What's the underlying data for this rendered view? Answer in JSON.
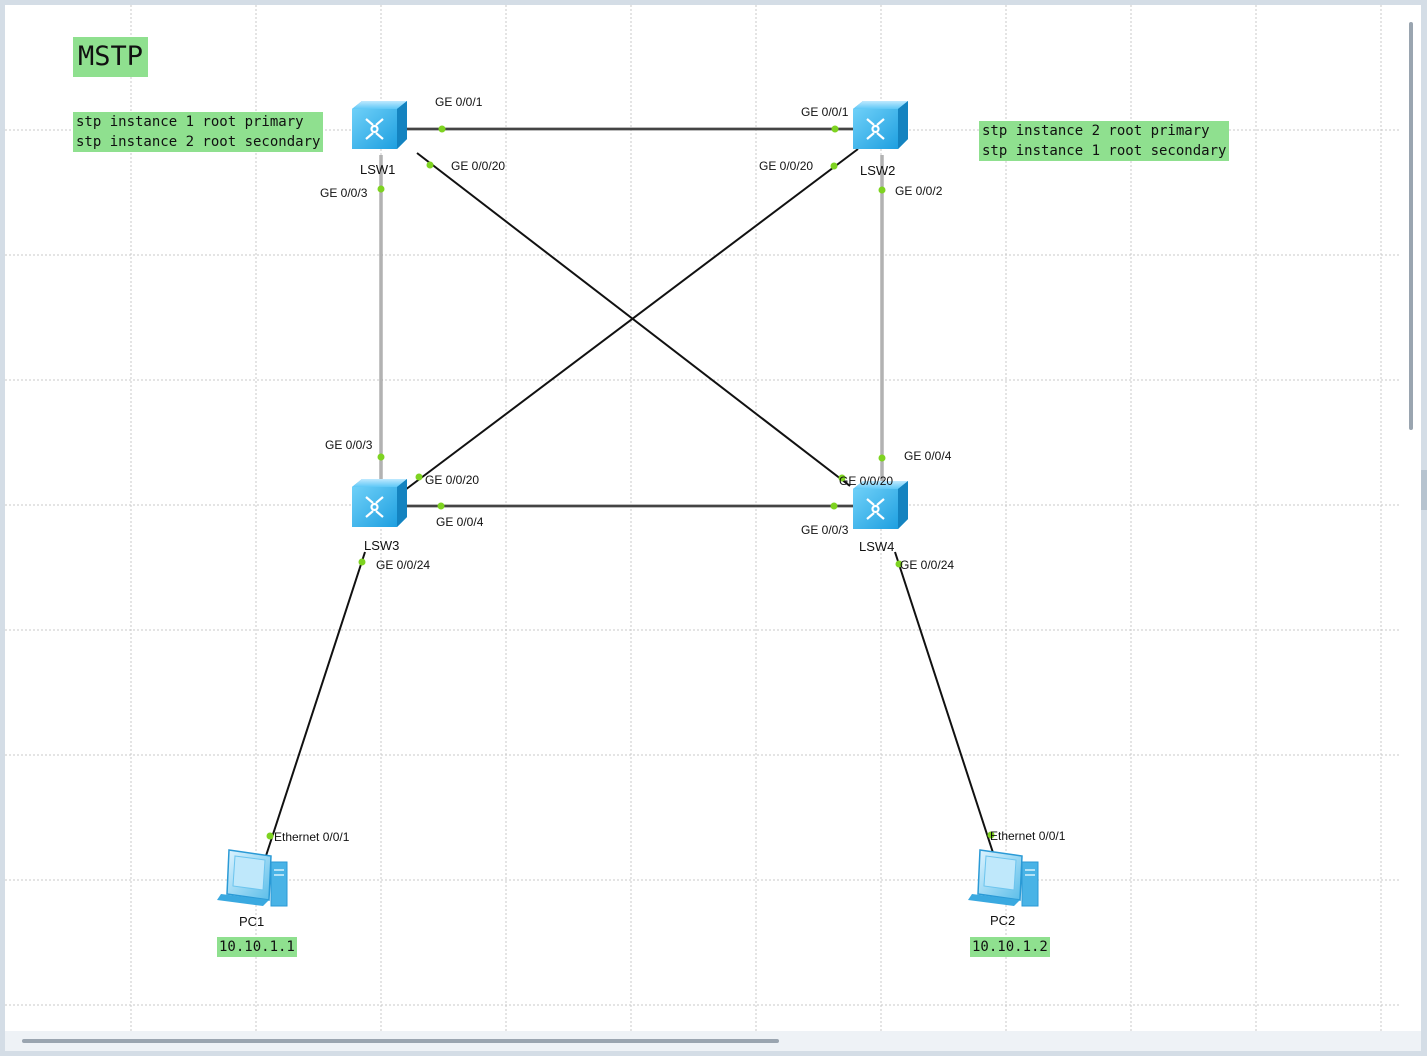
{
  "topology": {
    "title": "MSTP",
    "notes": {
      "lsw1_config": [
        "stp instance 1 root primary",
        "stp instance 2 root secondary"
      ],
      "lsw2_config": [
        "stp instance 2 root primary",
        "stp instance 1 root secondary"
      ]
    },
    "devices": {
      "lsw1": "LSW1",
      "lsw2": "LSW2",
      "lsw3": "LSW3",
      "lsw4": "LSW4",
      "pc1": "PC1",
      "pc2": "PC2"
    },
    "ip": {
      "pc1": "10.10.1.1",
      "pc2": "10.10.1.2"
    },
    "ports": {
      "lsw1_ge001": "GE 0/0/1",
      "lsw1_ge0020": "GE 0/0/20",
      "lsw1_ge003": "GE 0/0/3",
      "lsw2_ge001": "GE 0/0/1",
      "lsw2_ge0020": "GE 0/0/20",
      "lsw2_ge002": "GE 0/0/2",
      "lsw3_ge003": "GE 0/0/3",
      "lsw3_ge0020": "GE 0/0/20",
      "lsw3_ge004": "GE 0/0/4",
      "lsw3_ge0024": "GE 0/0/24",
      "lsw4_ge004": "GE 0/0/4",
      "lsw4_ge0020": "GE 0/0/20",
      "lsw4_ge003": "GE 0/0/3",
      "lsw4_ge0024": "GE 0/0/24",
      "pc1_eth": "Ethernet 0/0/1",
      "pc2_eth": "Ethernet 0/0/1"
    },
    "colors": {
      "note_bg": "#8fe08f",
      "port_dot": "#7ed321",
      "switch": "#33b4f0"
    }
  }
}
